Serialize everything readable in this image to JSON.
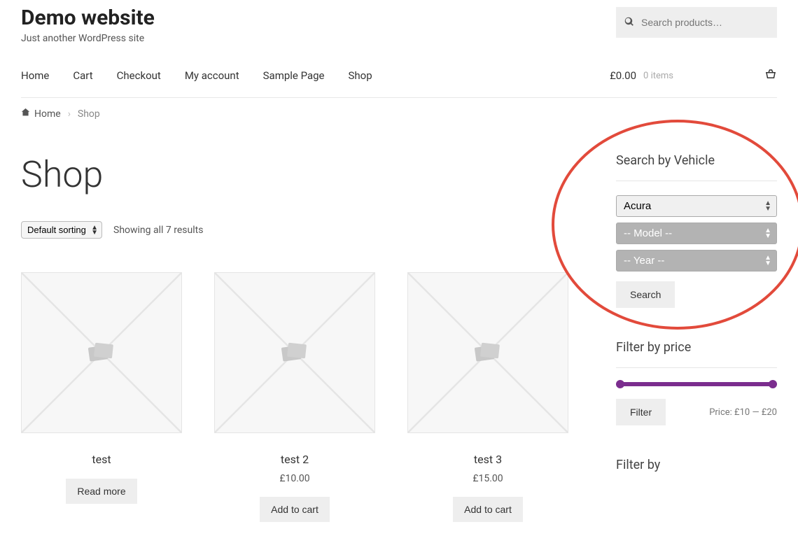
{
  "site": {
    "title": "Demo website",
    "tagline": "Just another WordPress site"
  },
  "search": {
    "placeholder": "Search products…"
  },
  "nav": {
    "items": [
      "Home",
      "Cart",
      "Checkout",
      "My account",
      "Sample Page",
      "Shop"
    ]
  },
  "cart": {
    "amount": "£0.00",
    "items": "0 items"
  },
  "breadcrumb": {
    "home": "Home",
    "current": "Shop"
  },
  "page": {
    "title": "Shop"
  },
  "sorting": {
    "selected": "Default sorting",
    "result_count": "Showing all 7 results"
  },
  "products": [
    {
      "name": "test",
      "price": "",
      "button": "Read more"
    },
    {
      "name": "test 2",
      "price": "£10.00",
      "button": "Add to cart"
    },
    {
      "name": "test 3",
      "price": "£15.00",
      "button": "Add to cart"
    }
  ],
  "sidebar": {
    "vehicle": {
      "title": "Search by Vehicle",
      "make": "Acura",
      "model": "-- Model --",
      "year": "-- Year --",
      "button": "Search"
    },
    "price": {
      "title": "Filter by price",
      "button": "Filter",
      "label": "Price: £10 — £20"
    },
    "filterby": {
      "title": "Filter by"
    }
  }
}
